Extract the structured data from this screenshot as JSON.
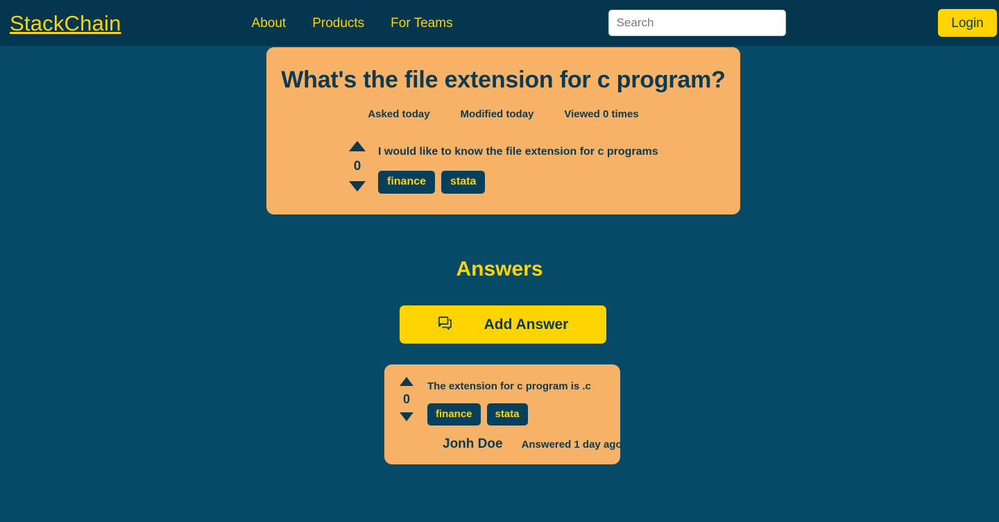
{
  "header": {
    "brand": "StackChain",
    "nav_items": [
      {
        "label": "About"
      },
      {
        "label": "Products"
      },
      {
        "label": "For Teams"
      }
    ],
    "search": {
      "placeholder": "Search",
      "value": ""
    },
    "login_label": "Login"
  },
  "question": {
    "title": "What's the file extension for c program?",
    "meta": [
      {
        "label": "Asked today"
      },
      {
        "label": "Modified today"
      },
      {
        "label": "Viewed 0 times"
      }
    ],
    "vote_count": "0",
    "body": "I would like to know the file extension for c programs",
    "tags": [
      {
        "label": "finance"
      },
      {
        "label": "stata"
      }
    ]
  },
  "answers_section": {
    "heading": "Answers",
    "add_answer_label": "Add Answer",
    "add_answer_icon": "chat-bubbles-icon",
    "items": [
      {
        "vote_count": "0",
        "body": "The extension for c program is .c",
        "tags": [
          {
            "label": "finance"
          },
          {
            "label": "stata"
          }
        ],
        "author": "Jonh Doe",
        "time": "Answered 1 day ago"
      }
    ]
  },
  "colors": {
    "page_background": "#074A68",
    "navbar_background": "#04374F",
    "accent_yellow": "#FFD400",
    "card_orange": "#F6B266",
    "dark_navy_text": "#0C3A52",
    "tag_background": "#06405C"
  }
}
